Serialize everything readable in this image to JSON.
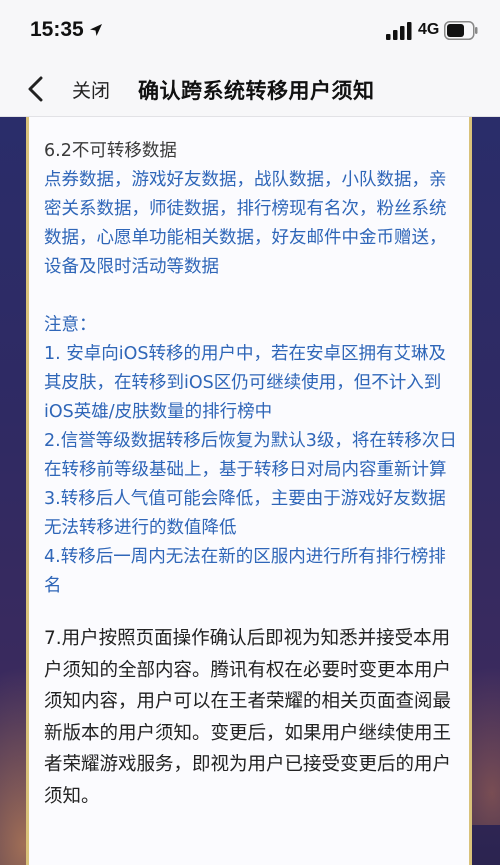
{
  "status_bar": {
    "time": "15:35",
    "network": "4G",
    "icons": [
      "location-arrow-icon",
      "signal-icon",
      "battery-icon"
    ]
  },
  "nav": {
    "close_label": "关闭",
    "title": "确认跨系统转移用户须知"
  },
  "content": {
    "section_heading": "6.2不可转移数据",
    "non_transferable": "点券数据，游戏好友数据，战队数据，小队数据，亲密关系数据，师徒数据，排行榜现有名次，粉丝系统数据，心愿单功能相关数据，好友邮件中金币赠送，设备及限时活动等数据",
    "note_title": "注意：",
    "notes": [
      "1. 安卓向iOS转移的用户中，若在安卓区拥有艾琳及其皮肤，在转移到iOS区仍可继续使用，但不计入到iOS英雄/皮肤数量的排行榜中",
      "2.信誉等级数据转移后恢复为默认3级，将在转移次日在转移前等级基础上，基于转移日对局内容重新计算",
      "3.转移后人气值可能会降低，主要由于游戏好友数据无法转移进行的数值降低",
      "4.转移后一周内无法在新的区服内进行所有排行榜排名"
    ],
    "final_notice": "7.用户按照页面操作确认后即视为知悉并接受本用户须知的全部内容。腾讯有权在必要时变更本用户须知内容，用户可以在王者荣耀的相关页面查阅最新版本的用户须知。变更后，如果用户继续使用王者荣耀游戏服务，即视为用户已接受变更后的用户须知。"
  },
  "colors": {
    "link_blue": "#2f66b8",
    "frame_gold": "#d9c27a",
    "frame_bg": "#2a2d6a"
  }
}
